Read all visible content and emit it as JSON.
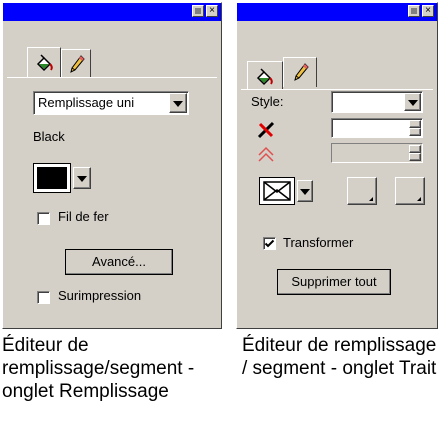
{
  "fill_panel": {
    "tabs": [
      "fill-bucket-icon",
      "pencil-icon"
    ],
    "fill_type_value": "Remplissage uni",
    "color_name": "Black",
    "color_swatch": "#000000",
    "wireframe_label": "Fil de fer",
    "wireframe_checked": false,
    "advanced_label": "Avancé...",
    "overprint_label": "Surimpression",
    "overprint_checked": false
  },
  "stroke_panel": {
    "tabs": [
      "fill-bucket-icon",
      "pencil-icon"
    ],
    "style_label": "Style:",
    "style_value": "",
    "width_value": "",
    "miter_value": "",
    "transform_label": "Transformer",
    "transform_checked": true,
    "delete_all_label": "Supprimer tout"
  },
  "captions": {
    "fill": "Éditeur de remplissage/segment - onglet Remplissage",
    "stroke": "Éditeur de remplissage / segment - onglet Trait"
  },
  "colors": {
    "titlebar": "#0000ff",
    "panel": "#d4d0c8"
  }
}
